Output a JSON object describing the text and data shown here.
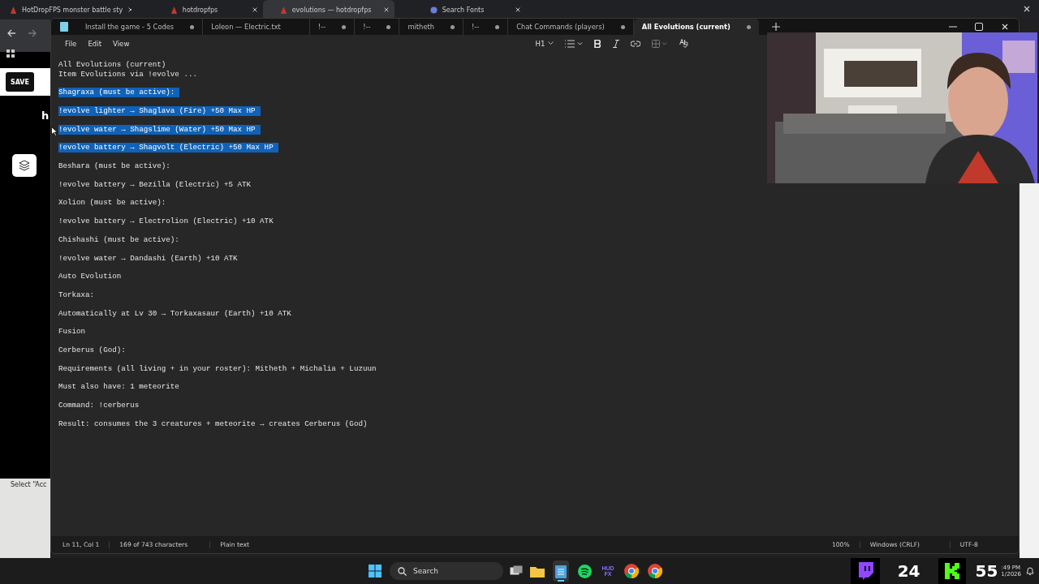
{
  "browser": {
    "tabs": [
      {
        "title": "HotDropFPS monster battle sty",
        "selected": false
      },
      {
        "title": "hotdropfps",
        "selected": false
      },
      {
        "title": "evolutions — hotdropfps",
        "selected": true
      },
      {
        "title": "Search Fonts",
        "selected": false
      }
    ],
    "page": {
      "save_button": "SAVE",
      "heading": "h",
      "footer_text": "Select “Acc"
    }
  },
  "notepad": {
    "tabs": [
      {
        "title": "Install the game - 5 Codes",
        "modified": true,
        "selected": false
      },
      {
        "title": "Loleon — Electric.txt",
        "modified": false,
        "selected": false
      },
      {
        "title": "!--",
        "modified": true,
        "selected": false
      },
      {
        "title": "!--",
        "modified": true,
        "selected": false
      },
      {
        "title": "mitheth",
        "modified": true,
        "selected": false
      },
      {
        "title": "!--",
        "modified": true,
        "selected": false
      },
      {
        "title": "Chat Commands (players)",
        "modified": true,
        "selected": false
      },
      {
        "title": "All Evolutions (current)",
        "modified": true,
        "selected": true
      }
    ],
    "menu": [
      "File",
      "Edit",
      "View"
    ],
    "heading_menu": "H1",
    "header_lines": [
      "All Evolutions (current)",
      "Item Evolutions via !evolve ..."
    ],
    "lines": [
      {
        "text": "Shagraxa (must be active):",
        "selected": true
      },
      {
        "text": "!evolve lighter → Shaglava (Fire) +50 Max HP",
        "selected": true
      },
      {
        "text": "!evolve water → Shagslime (Water) +50 Max HP",
        "selected": true
      },
      {
        "text": "!evolve battery → Shagvolt (Electric) +50 Max HP",
        "selected": true
      },
      {
        "text": "Beshara (must be active):",
        "selected": false
      },
      {
        "text": "!evolve battery → Bezilla (Electric) +5 ATK",
        "selected": false
      },
      {
        "text": "Xolion (must be active):",
        "selected": false
      },
      {
        "text": "!evolve battery → Electrolion (Electric) +10 ATK",
        "selected": false
      },
      {
        "text": "Chishashi (must be active):",
        "selected": false
      },
      {
        "text": "!evolve water → Dandashi (Earth) +10 ATK",
        "selected": false
      },
      {
        "text": "Auto Evolution",
        "selected": false
      },
      {
        "text": "Torkaxa:",
        "selected": false
      },
      {
        "text": "Automatically at Lv 30 → Torkaxasaur (Earth) +10 ATK",
        "selected": false
      },
      {
        "text": "Fusion",
        "selected": false
      },
      {
        "text": "Cerberus (God):",
        "selected": false
      },
      {
        "text": "Requirements (all living + in your roster): Mitheth + Michalia + Luzuun",
        "selected": false
      },
      {
        "text": "Must also have: 1 meteorite",
        "selected": false
      },
      {
        "text": "Command: !cerberus",
        "selected": false
      },
      {
        "text": "Result: consumes the 3 creatures + meteorite → creates Cerberus (God)",
        "selected": false
      }
    ],
    "status_bar": {
      "position": "Ln 11, Col 1",
      "count": "169 of 743 characters",
      "format": "Plain text",
      "zoom": "100%",
      "line_ending": "Windows (CRLF)",
      "encoding": "UTF-8"
    }
  },
  "taskbar": {
    "search": "Search",
    "apps": [
      {
        "kind": "folder",
        "selected": false
      },
      {
        "kind": "notepad",
        "selected": true
      },
      {
        "kind": "spotify",
        "selected": false
      },
      {
        "kind": "hud",
        "label": "HUD FX",
        "selected": false
      },
      {
        "kind": "chrome",
        "selected": false
      },
      {
        "kind": "chrome",
        "selected": false
      }
    ],
    "overlay_counts": [
      "24",
      "55"
    ],
    "clock": [
      ":49 PM",
      "1/2026"
    ]
  }
}
